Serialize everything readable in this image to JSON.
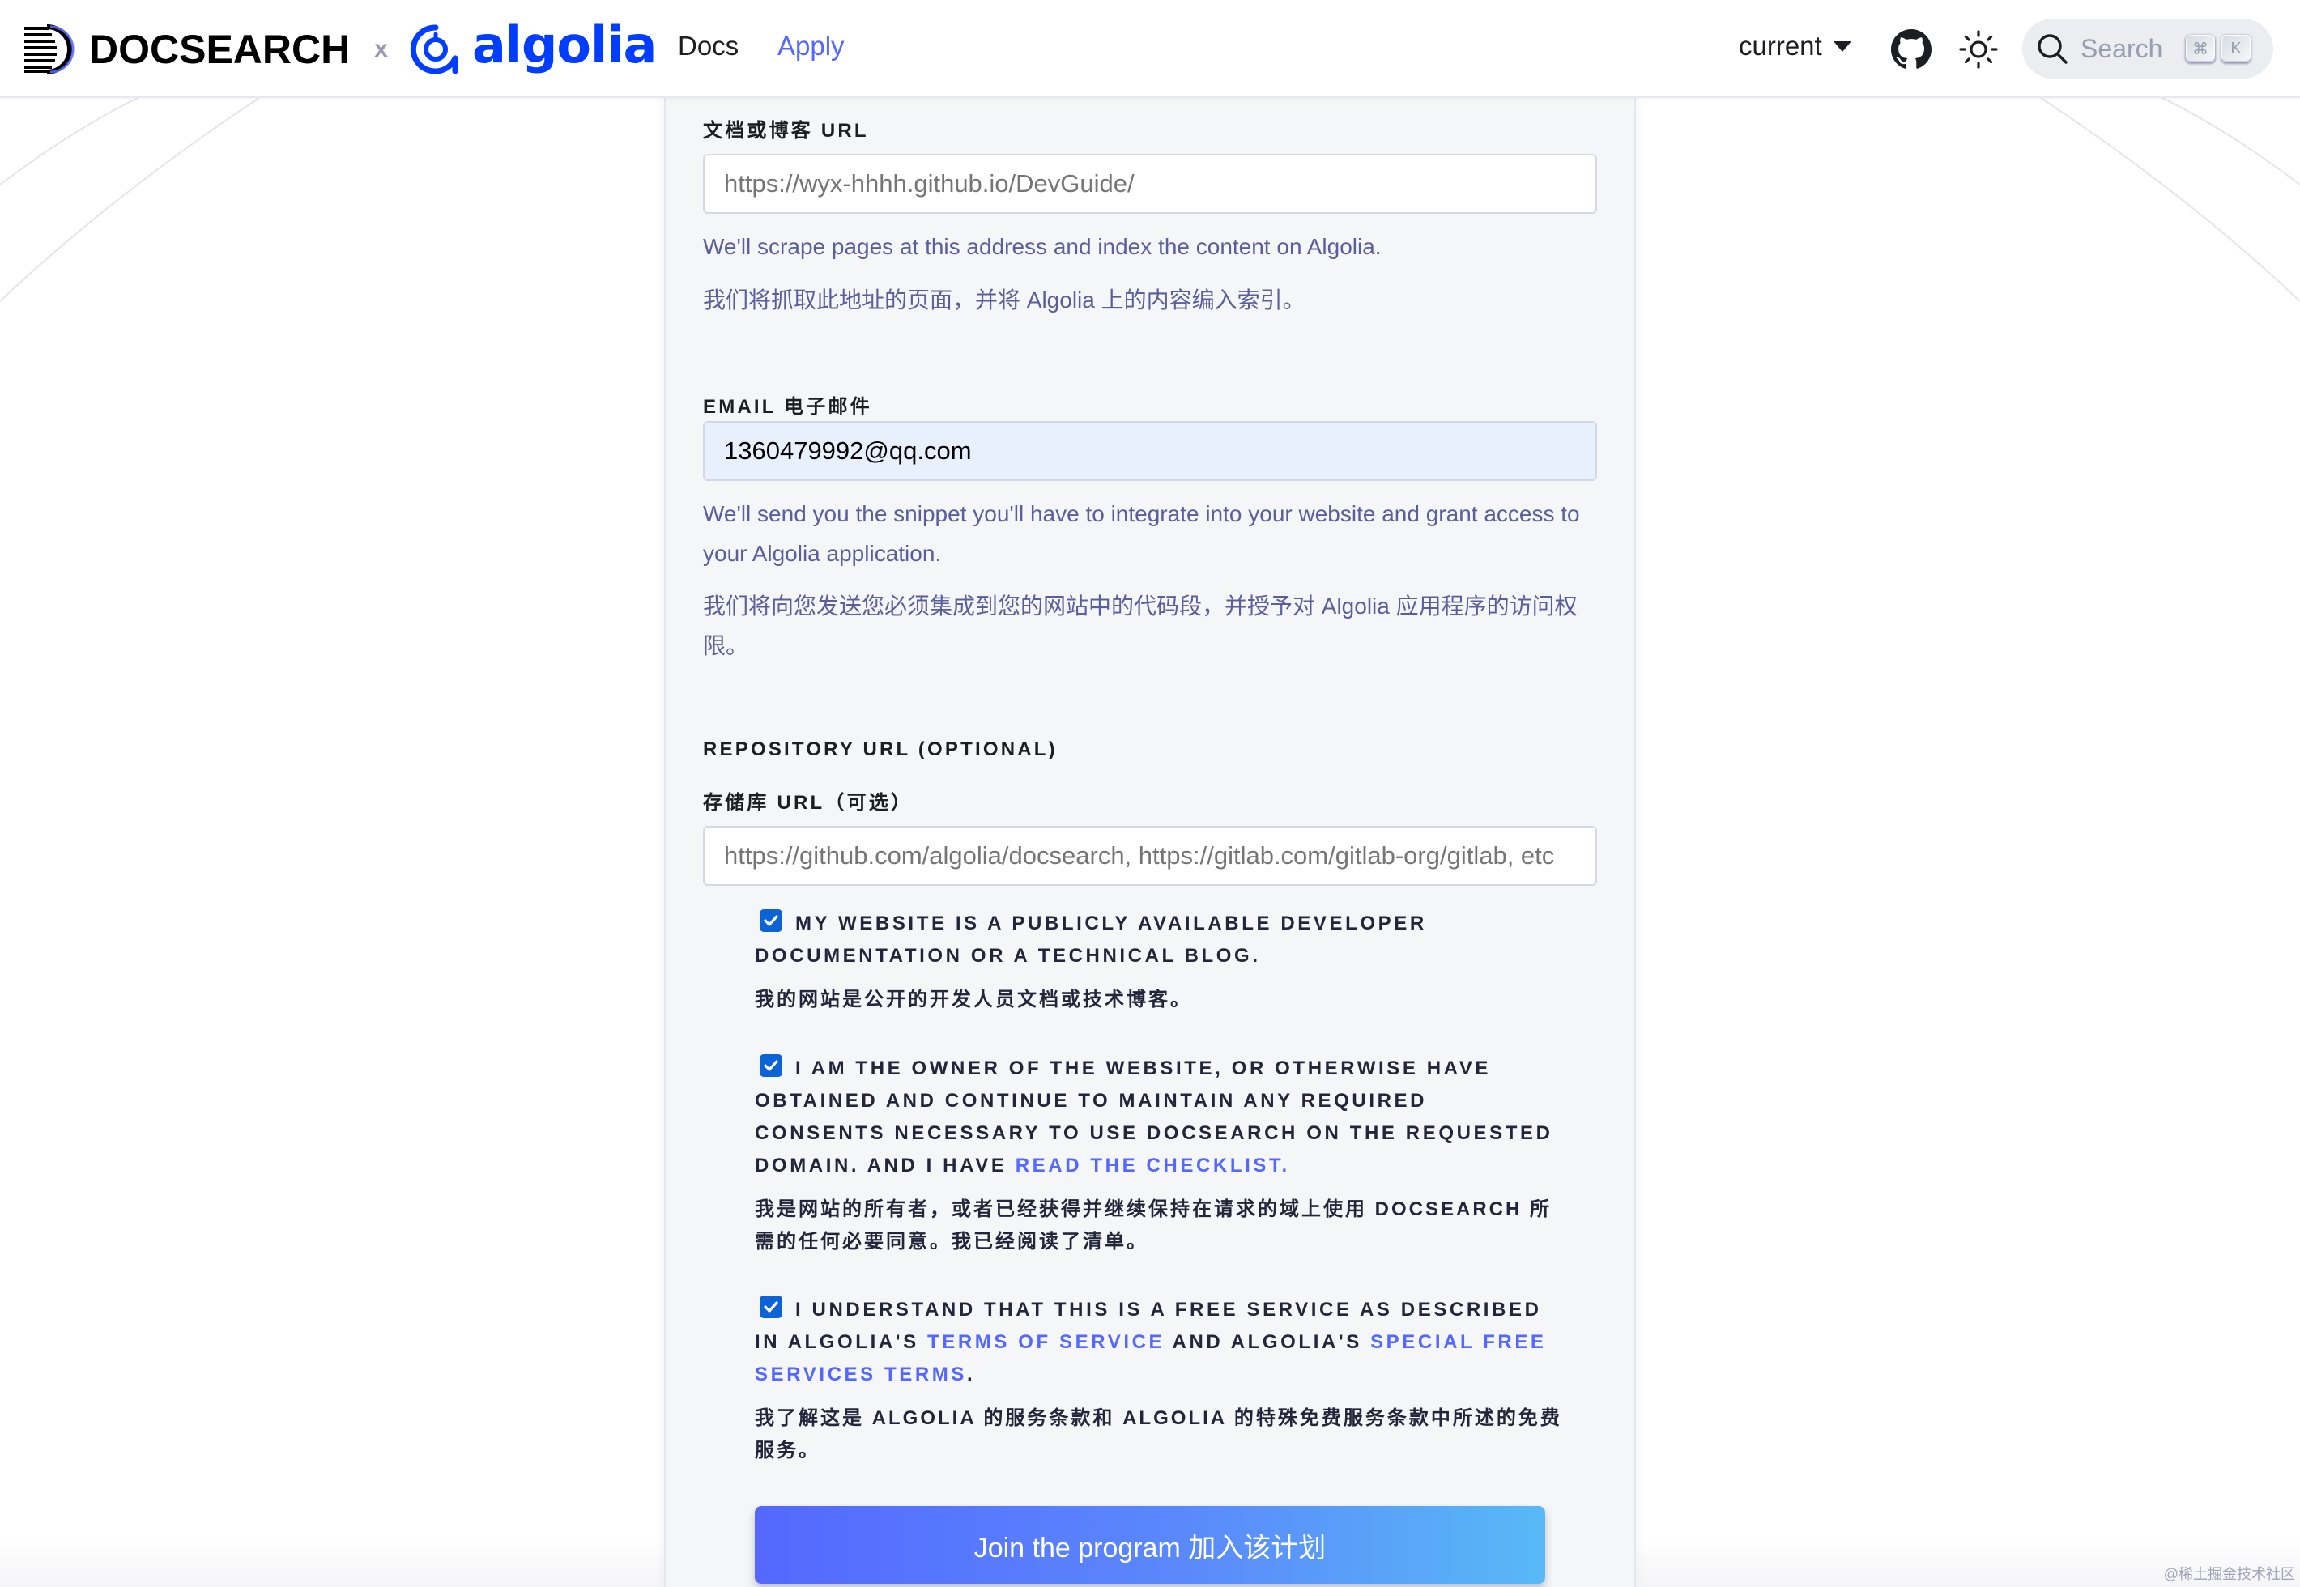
{
  "navbar": {
    "brand_docsearch": "DOCSEARCH",
    "brand_x": "x",
    "brand_algolia": "algolia",
    "links": {
      "docs": "Docs",
      "apply": "Apply"
    },
    "version": "current",
    "search": {
      "placeholder": "Search",
      "kbd_1": "⌘",
      "kbd_2": "K"
    }
  },
  "form": {
    "url_field": {
      "label": "文档或博客 URL",
      "placeholder": "https://wyx-hhhh.github.io/DevGuide/",
      "help_en": "We'll scrape pages at this address and index the content on Algolia.",
      "help_cn": "我们将抓取此地址的页面，并将 Algolia 上的内容编入索引。"
    },
    "email_field": {
      "label": "EMAIL 电子邮件",
      "value": "1360479992@qq.com",
      "help_en": "We'll send you the snippet you'll have to integrate into your website and grant access to your Algolia application.",
      "help_cn": "我们将向您发送您必须集成到您的网站中的代码段，并授予对 Algolia 应用程序的访问权限。"
    },
    "repo_field": {
      "label_en": "REPOSITORY URL (OPTIONAL)",
      "label_cn": "存储库 URL（可选）",
      "placeholder": "https://github.com/algolia/docsearch, https://gitlab.com/gitlab-org/gitlab, etc"
    },
    "checks": [
      {
        "checked": true,
        "text": "My website is a publicly available developer documentation or a technical blog.",
        "cn": "我的网站是公开的开发人员文档或技术博客。"
      },
      {
        "checked": true,
        "text_before": "I am the owner of the website, or otherwise have obtained and continue to maintain any required consents necessary to use DocSearch on the requested domain. And I have ",
        "link": "read the checklist.",
        "cn": "我是网站的所有者，或者已经获得并继续保持在请求的域上使用 DOCSEARCH 所需的任何必要同意。我已经阅读了清单。"
      },
      {
        "checked": true,
        "text_before": "I understand that this is a free service as described in Algolia's ",
        "link_1": "Terms of Service",
        "text_mid": " and Algolia's ",
        "link_2": "Special Free Services Terms",
        "text_after": ".",
        "cn": "我了解这是 ALGOLIA 的服务条款和 ALGOLIA 的特殊免费服务条款中所述的免费服务。"
      }
    ],
    "submit_label": "Join the program 加入该计划"
  },
  "watermark": "@稀土掘金技术社区",
  "colors": {
    "accent": "#5468ff",
    "algolia_blue": "#003dff",
    "checkbox": "#0b63d6",
    "autofill_bg": "#e8f0fe"
  }
}
